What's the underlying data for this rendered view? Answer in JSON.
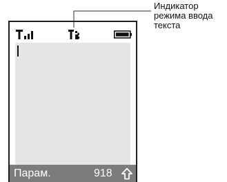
{
  "status_bar": {
    "signal_icon": "signal-strength-icon",
    "mode_icon": "text-input-mode-icon",
    "battery_icon": "battery-icon"
  },
  "editor": {
    "text": ""
  },
  "softkey": {
    "left_label": "Парам.",
    "char_count": "918",
    "shift_icon": "up-arrow-icon"
  },
  "callout": {
    "label": "Индикатор режима ввода текста"
  },
  "colors": {
    "screen_bg": "#e6e6e6",
    "softkey_bg": "#7c7c7c",
    "border": "#1f1f1f"
  }
}
